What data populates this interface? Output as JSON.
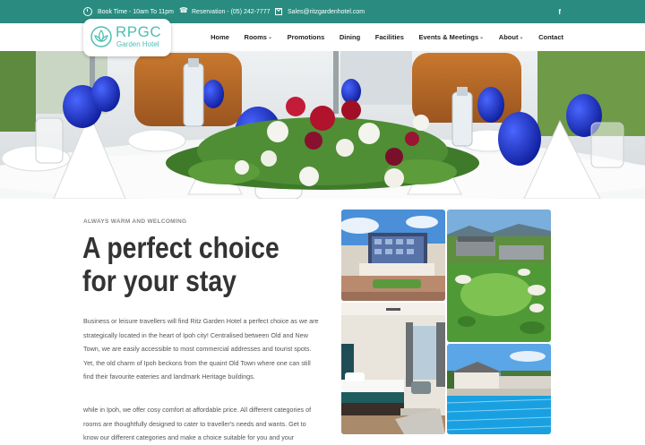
{
  "topbar": {
    "book_time": "Book Time - 10am To 11pm",
    "reservation": "Reservation - (05) 242-7777",
    "email": "Sales@ritzgardenhotel.com",
    "social": "f"
  },
  "logo": {
    "brand": "RPGC",
    "subtitle": "Garden Hotel"
  },
  "nav": {
    "items": [
      {
        "label": "Home"
      },
      {
        "label": "Rooms",
        "chevron": "⌄"
      },
      {
        "label": "Promotions"
      },
      {
        "label": "Dining"
      },
      {
        "label": "Facilities"
      },
      {
        "label": "Events & Meetings",
        "chevron": "⌄"
      },
      {
        "label": "About",
        "chevron": "⌄"
      },
      {
        "label": "Contact"
      }
    ]
  },
  "main": {
    "tagline": "ALWAYS WARM AND WELCOMING",
    "headline": "A perfect choice for your stay",
    "paragraph1": "Business or leisure travellers will find Ritz Garden Hotel a perfect choice as we are strategically located in the heart of Ipoh city! Centralised between Old and New Town, we are easily accessible to most commercial addresses and tourist spots. Yet, the old charm of Ipoh beckons from the quaint Old Town where one can still find their favourite eateries and landmark Heritage buildings.",
    "paragraph2": "while in Ipoh, we offer cosy comfort at affordable price. All different categories of rooms are thoughtfully designed to cater to traveller's needs and wants. Get to know our different categories and make a choice suitable for you and your"
  },
  "colors": {
    "topbar": "#2a8c80",
    "brand": "#4dbfb3",
    "headline": "#333333",
    "body_text": "#555555"
  }
}
